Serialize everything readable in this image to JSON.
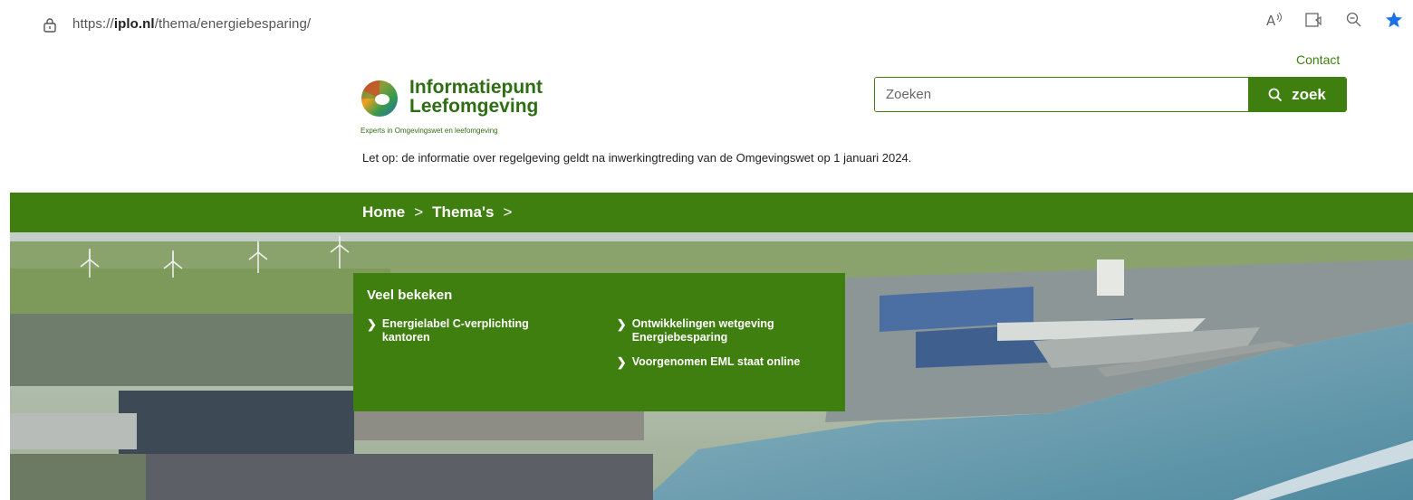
{
  "browser": {
    "url_prefix": "https://",
    "url_domain": "iplo.nl",
    "url_path": "/thema/energiebesparing/",
    "icons": [
      "read-aloud-icon",
      "immersive-reader-icon",
      "zoom-out-icon",
      "favorite-star-icon"
    ]
  },
  "header": {
    "contact_label": "Contact",
    "logo_line1": "Informatiepunt",
    "logo_line2": "Leefomgeving",
    "logo_tagline": "Experts in Omgevingswet en leefomgeving",
    "search_placeholder": "Zoeken",
    "search_button_label": "zoek",
    "notice": "Let op: de informatie over regelgeving geldt na inwerkingtreding van de Omgevingswet op 1 januari 2024."
  },
  "breadcrumb": {
    "items": [
      "Home",
      "Thema's"
    ],
    "separator": ">"
  },
  "popular": {
    "title": "Veel bekeken",
    "links": [
      {
        "line1": "Energielabel C-verplichting",
        "line2": "kantoren"
      },
      {
        "line1": "Ontwikkelingen wetgeving",
        "line2": "Energiebesparing"
      },
      {
        "line1": "Voorgenomen EML staat online",
        "line2": ""
      }
    ]
  },
  "colors": {
    "brand_green": "#3f7f0f",
    "text_dark": "#222222"
  }
}
